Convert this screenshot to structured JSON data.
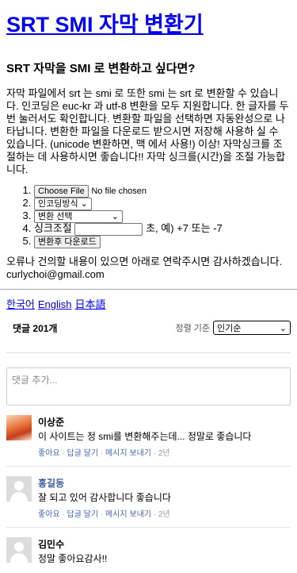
{
  "title": "SRT SMI 자막 변환기",
  "question": "SRT 자막을 SMI 로 변환하고 싶다면?",
  "description": "자막 파일에서 srt 는 smi 로 또한 smi 는 srt 로 변환할 수 있습니다. 인코딩은 euc-kr 과 utf-8 변환을 모두 지원합니다. 한 글자를 두 번 눌러서도 확인합니다. 변환할 파일을 선택하면 자동완성으로 나타납니다. 변환한 파일을 다운로드 받으시면 저장해 사용하 실 수 있습니다. (unicode 변환하면, 맥 에서 사용!) 이상! 자막싱크를 조절하는 데 사용하시면 좋습니다!! 자막 싱크를(시간)을 조절 가능합니다.",
  "form": {
    "file_button": "Choose File",
    "file_status": "No file chosen",
    "encoding_select": "인코딩방식",
    "convert_select": "변환 선택",
    "sync_placeholder": "",
    "sync_label": "초, 예) +7 또는 -7",
    "sync_prefix": "싱크조절",
    "submit_button": "변환후 다운로드"
  },
  "note": "오류나 건의할 내용이 있으면 아래로 연락주시면 감사하겠습니다.",
  "email": "curlychoi@gmail.com",
  "languages": [
    "한국어",
    "English",
    "日本語"
  ],
  "comments": {
    "count": "댓글 201개",
    "sort_label": "정렬 기준",
    "sort_value": "인기순",
    "input_placeholder": "댓글 추가...",
    "items": [
      {
        "name": "이상준",
        "text": "이 사이트는 정 smi를 변환해주는데... 정말로 좋습니다",
        "actions": [
          "좋아요",
          "답글 달기",
          "메시지 보내기"
        ],
        "time": "2년"
      },
      {
        "name": "홍길동",
        "text": "잘 되고 있어 감사합니다 좋습니다",
        "actions": [
          "좋아요",
          "답글 달기",
          "메시지 보내기"
        ],
        "time": "2년"
      },
      {
        "name": "김민수",
        "text": "정말 좋아요감사!!",
        "actions": [],
        "time": ""
      }
    ]
  }
}
